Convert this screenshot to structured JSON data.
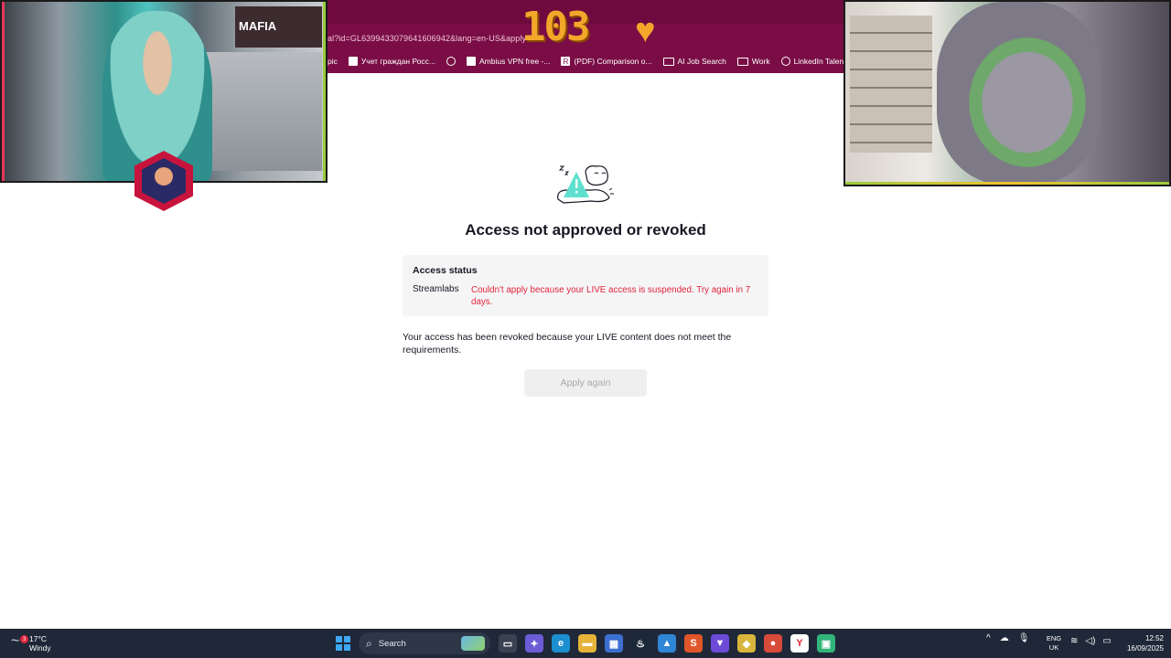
{
  "browser": {
    "address_fragment": "al?id=GL6399433079641606942&lang=en-US&apply",
    "counter": "103",
    "bookmarks": [
      {
        "label": "pic",
        "icon": "none"
      },
      {
        "label": "Учет граждан Росс...",
        "icon": "file-icon"
      },
      {
        "label": "",
        "icon": "globe-icon"
      },
      {
        "label": "Ambius VPN free -...",
        "icon": "file-icon"
      },
      {
        "label": "(PDF) Comparison o...",
        "icon": "researchgate-icon"
      },
      {
        "label": "AI Job Search",
        "icon": "folder-icon"
      },
      {
        "label": "Work",
        "icon": "folder-icon"
      },
      {
        "label": "LinkedIn Talent Solu...",
        "icon": "linkedin-icon"
      }
    ]
  },
  "overlay": {
    "poster_text": "MAFIA"
  },
  "main": {
    "title": "Access not approved or revoked",
    "status_card": {
      "heading": "Access status",
      "app_name": "Streamlabs",
      "message": "Couldn't apply because your LIVE access is suspended. Try again in 7 days."
    },
    "revoked_message": "Your access has been revoked because your LIVE content does not meet the requirements.",
    "apply_button": "Apply again"
  },
  "taskbar": {
    "weather_temp": "17°C",
    "weather_desc": "Windy",
    "weather_badge": "3",
    "search_placeholder": "Search",
    "language_primary": "ENG",
    "language_secondary": "UK",
    "time": "12:52",
    "date": "16/09/2025",
    "apps": [
      {
        "name": "task-view-icon",
        "color": "#3a4252",
        "glyph": "▭"
      },
      {
        "name": "copilot-icon",
        "color": "#6b5cd6",
        "glyph": "✦"
      },
      {
        "name": "edge-icon",
        "color": "#1b8fd0",
        "glyph": "e"
      },
      {
        "name": "file-explorer-icon",
        "color": "#e6b33a",
        "glyph": "▬"
      },
      {
        "name": "store-icon",
        "color": "#3b6fd1",
        "glyph": "▦"
      },
      {
        "name": "steam-icon",
        "color": "#1b2838",
        "glyph": "♨"
      },
      {
        "name": "photos-icon",
        "color": "#2f86d6",
        "glyph": "▲"
      },
      {
        "name": "streamlabs-app-icon",
        "color": "#e0562a",
        "glyph": "S"
      },
      {
        "name": "proton-icon",
        "color": "#6d4ad8",
        "glyph": "▼"
      },
      {
        "name": "game-icon",
        "color": "#d9b53c",
        "glyph": "◆"
      },
      {
        "name": "chrome-icon",
        "color": "#d84a3a",
        "glyph": "●"
      },
      {
        "name": "yandex-icon",
        "color": "#ffffff",
        "glyph": "Y"
      },
      {
        "name": "active-app-icon",
        "color": "#32b57a",
        "glyph": "▣"
      }
    ]
  },
  "colors": {
    "error_red": "#e0243b",
    "chrome_bg": "#7a0d45",
    "counter_orange": "#f3a72a",
    "taskbar_bg": "#1f2838"
  }
}
